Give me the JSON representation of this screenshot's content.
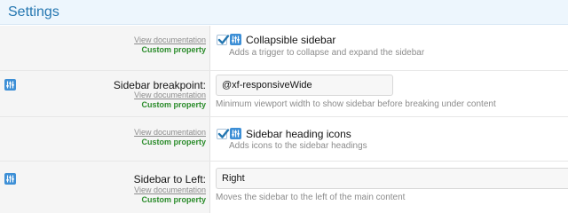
{
  "header": {
    "title": "Settings"
  },
  "rows": [
    {
      "doc_link": "View documentation",
      "custom": "Custom property",
      "type": "checkbox",
      "label": "Collapsible sidebar",
      "checked": true,
      "hint": "Adds a trigger to collapse and expand the sidebar"
    },
    {
      "doc_link": "View documentation",
      "custom": "Custom property",
      "type": "text",
      "label": "Sidebar breakpoint:",
      "value": "@xf-responsiveWide",
      "hint": "Minimum viewport width to show sidebar before breaking under content"
    },
    {
      "doc_link": "View documentation",
      "custom": "Custom property",
      "type": "checkbox",
      "label": "Sidebar heading icons",
      "checked": true,
      "hint": "Adds icons to the sidebar headings"
    },
    {
      "doc_link": "View documentation",
      "custom": "Custom property",
      "type": "text",
      "label": "Sidebar to Left:",
      "value": "Right",
      "hint": "Moves the sidebar to the left of the main content"
    }
  ],
  "colors": {
    "accent": "#2577b1",
    "header_bg": "#edf6fd",
    "icon_bg": "#3d8fd6",
    "custom_green": "#2b8c2b",
    "muted": "#8c8c8c"
  },
  "icons": {
    "property": "sliders-icon",
    "check": "checkmark-icon"
  }
}
